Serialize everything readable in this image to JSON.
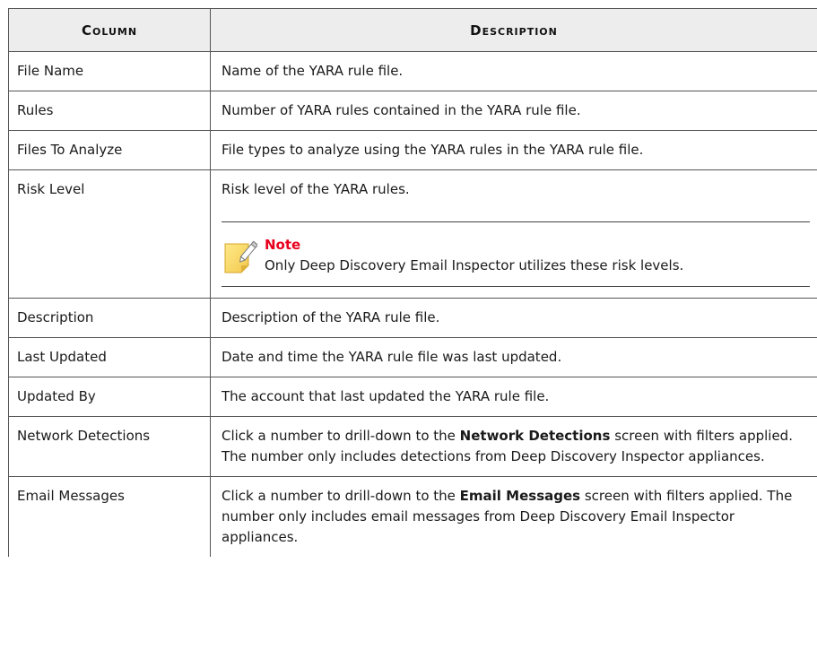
{
  "header": {
    "column": "Column",
    "description": "Description"
  },
  "rows": [
    {
      "name": "File Name",
      "desc": "Name of the YARA rule file."
    },
    {
      "name": "Rules",
      "desc": "Number of YARA rules contained in the YARA rule file."
    },
    {
      "name": "Files To Analyze",
      "desc": "File types to analyze using the YARA rules in the YARA rule file."
    },
    {
      "name": "Risk Level",
      "desc": "Risk level of the YARA rules."
    },
    {
      "name": "Description",
      "desc": "Description of the YARA rule file."
    },
    {
      "name": "Last Updated",
      "desc": "Date and time the YARA rule file was last updated."
    },
    {
      "name": "Updated By",
      "desc": "The account that last updated the YARA rule file."
    },
    {
      "name": "Network Detections",
      "desc_pre": "Click a number to drill-down to the ",
      "desc_bold": "Network Detections",
      "desc_post": " screen with filters applied. The number only includes detections from Deep Discovery Inspector appliances."
    },
    {
      "name": "Email Messages",
      "desc_pre": "Click a number to drill-down to the ",
      "desc_bold": "Email Messages",
      "desc_post": " screen with filters applied. The number only includes email messages from Deep Discovery Email Inspector appliances."
    }
  ],
  "note": {
    "title": "Note",
    "text": "Only Deep Discovery Email Inspector utilizes these risk levels.",
    "icon": "note-pencil-icon"
  },
  "colors": {
    "header_bg": "#ededed",
    "note_title": "#e8001c",
    "border": "#555555"
  }
}
